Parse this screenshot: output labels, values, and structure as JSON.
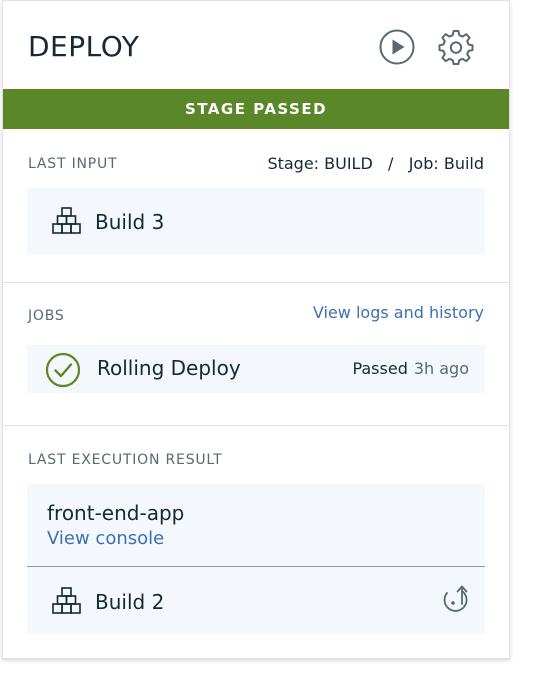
{
  "header": {
    "title": "DEPLOY",
    "icons": [
      "play-icon",
      "gear-icon"
    ]
  },
  "status": {
    "label": "STAGE PASSED",
    "color": "#5a8727"
  },
  "last_input": {
    "label": "LAST INPUT",
    "stage_job": "Stage: BUILD   /   Job: Build",
    "build": {
      "icon": "build-blocks-icon",
      "label": "Build 3"
    }
  },
  "jobs": {
    "label": "JOBS",
    "link": "View logs and history",
    "items": [
      {
        "icon": "check-circle-icon",
        "name": "Rolling Deploy",
        "status": "Passed",
        "time": "3h ago"
      }
    ]
  },
  "last_execution": {
    "label": "LAST EXECUTION RESULT",
    "app_name": "front-end-app",
    "console_link": "View console",
    "build": {
      "icon": "build-blocks-icon",
      "label": "Build 2",
      "action_icon": "redeploy-icon"
    }
  },
  "colors": {
    "accent": "#3d70b2",
    "success": "#5a8727",
    "tile_bg": "#f4f7fb"
  }
}
